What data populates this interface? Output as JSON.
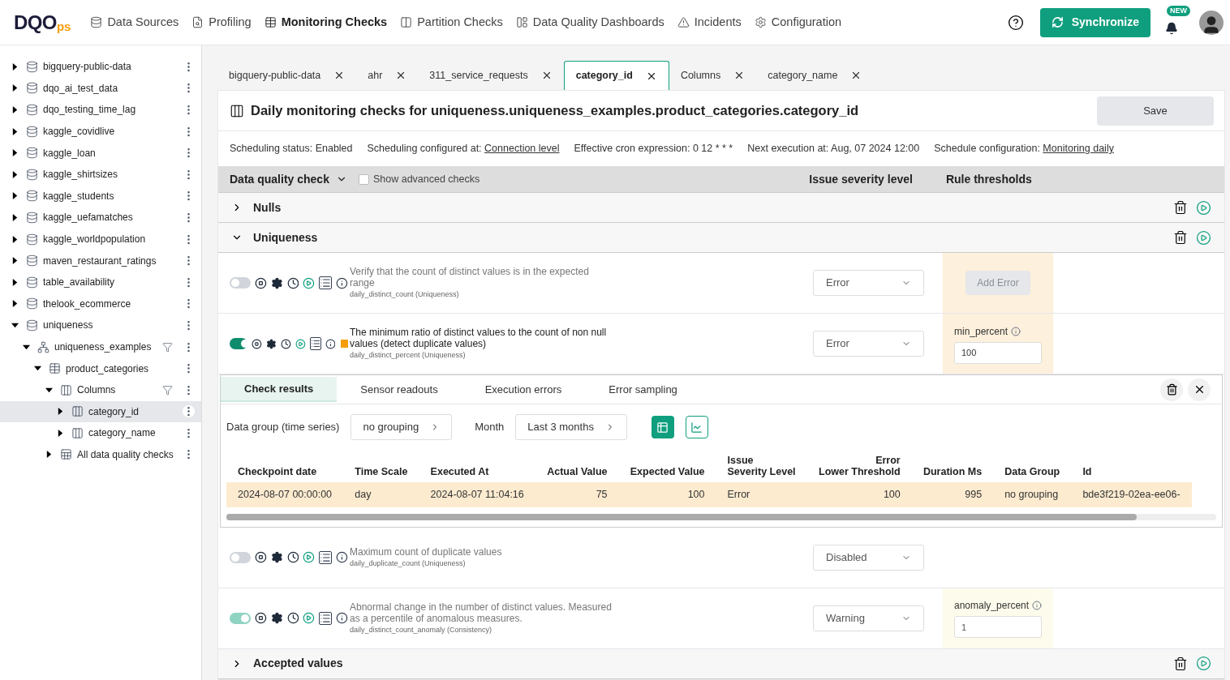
{
  "logo": {
    "main": "DQO",
    "suffix": "ps"
  },
  "nav": [
    {
      "label": "Data Sources",
      "selected": false
    },
    {
      "label": "Profiling",
      "selected": false
    },
    {
      "label": "Monitoring Checks",
      "selected": true
    },
    {
      "label": "Partition Checks",
      "selected": false
    },
    {
      "label": "Data Quality Dashboards",
      "selected": false
    },
    {
      "label": "Incidents",
      "selected": false
    },
    {
      "label": "Configuration",
      "selected": false
    }
  ],
  "sync_button": "Synchronize",
  "notifications_badge": "NEW",
  "tree": [
    {
      "label": "bigquery-public-data",
      "kind": "connection",
      "expanded": false,
      "selected": false,
      "filter": false
    },
    {
      "label": "dqo_ai_test_data",
      "kind": "connection",
      "expanded": false,
      "selected": false,
      "filter": false
    },
    {
      "label": "dqo_testing_time_lag",
      "kind": "connection",
      "expanded": false,
      "selected": false,
      "filter": false
    },
    {
      "label": "kaggle_covidlive",
      "kind": "connection",
      "expanded": false,
      "selected": false,
      "filter": false
    },
    {
      "label": "kaggle_loan",
      "kind": "connection",
      "expanded": false,
      "selected": false,
      "filter": false
    },
    {
      "label": "kaggle_shirtsizes",
      "kind": "connection",
      "expanded": false,
      "selected": false,
      "filter": false
    },
    {
      "label": "kaggle_students",
      "kind": "connection",
      "expanded": false,
      "selected": false,
      "filter": false
    },
    {
      "label": "kaggle_uefamatches",
      "kind": "connection",
      "expanded": false,
      "selected": false,
      "filter": false
    },
    {
      "label": "kaggle_worldpopulation",
      "kind": "connection",
      "expanded": false,
      "selected": false,
      "filter": false
    },
    {
      "label": "maven_restaurant_ratings",
      "kind": "connection",
      "expanded": false,
      "selected": false,
      "filter": false
    },
    {
      "label": "table_availability",
      "kind": "connection",
      "expanded": false,
      "selected": false,
      "filter": false
    },
    {
      "label": "thelook_ecommerce",
      "kind": "connection",
      "expanded": false,
      "selected": false,
      "filter": false
    },
    {
      "label": "uniqueness",
      "kind": "connection",
      "expanded": true,
      "selected": false,
      "filter": false,
      "children": [
        {
          "label": "uniqueness_examples",
          "kind": "schema",
          "expanded": true,
          "selected": false,
          "filter": true,
          "children": [
            {
              "label": "product_categories",
              "kind": "table",
              "expanded": true,
              "selected": false,
              "filter": false,
              "children": [
                {
                  "label": "Columns",
                  "kind": "column",
                  "expanded": true,
                  "selected": false,
                  "filter": true,
                  "children": [
                    {
                      "label": "category_id",
                      "kind": "column",
                      "expanded": false,
                      "selected": true,
                      "filter": false
                    },
                    {
                      "label": "category_name",
                      "kind": "column",
                      "expanded": false,
                      "selected": false,
                      "filter": false
                    }
                  ]
                },
                {
                  "label": "All data quality checks",
                  "kind": "checks",
                  "expanded": false,
                  "selected": false,
                  "filter": false
                }
              ]
            }
          ]
        }
      ]
    }
  ],
  "tabs": [
    {
      "label": "bigquery-public-data",
      "selected": false
    },
    {
      "label": "ahr",
      "selected": false
    },
    {
      "label": "311_service_requests",
      "selected": false
    },
    {
      "label": "category_id",
      "selected": true
    },
    {
      "label": "Columns",
      "selected": false
    },
    {
      "label": "category_name",
      "selected": false
    }
  ],
  "title": "Daily monitoring checks for uniqueness.uniqueness_examples.product_categories.category_id",
  "save_button": "Save",
  "schedule": [
    {
      "label": "Scheduling status:",
      "value": "Enabled",
      "link": false
    },
    {
      "label": "Scheduling configured at:",
      "value": "Connection level",
      "link": true
    },
    {
      "label": "Effective cron expression:",
      "value": "0 12 * * *",
      "link": false
    },
    {
      "label": "Next execution at:",
      "value": "Aug, 07 2024 12:00",
      "link": false
    },
    {
      "label": "Schedule configuration:",
      "value": "Monitoring daily",
      "link": true
    }
  ],
  "header": {
    "check": "Data quality check",
    "advanced": {
      "label": "Show advanced checks",
      "checked": false
    },
    "severity": "Issue severity level",
    "thresholds": "Rule thresholds"
  },
  "categories": [
    {
      "name": "Nulls",
      "expanded": false
    },
    {
      "name": "Uniqueness",
      "expanded": true,
      "checks": [
        {
          "on": false,
          "muted": true,
          "description": "Verify that the count of distinct values is in the expected range",
          "name": "daily_distinct_count (Uniqueness)",
          "severity": "Error",
          "threshold": {
            "kind": "button",
            "color": "#fdf0dc",
            "label": "Add Error"
          }
        },
        {
          "on": true,
          "muted": false,
          "color": "#f59e0b",
          "description": "The minimum ratio of distinct values to the count of non null values (detect duplicate values)",
          "name": "daily_distinct_percent (Uniqueness)",
          "severity": "Error",
          "threshold": {
            "kind": "field",
            "color": "#fdf0dc",
            "label": "min_percent",
            "value": "100"
          },
          "results": {
            "tabs": [
              {
                "label": "Check results",
                "selected": true
              },
              {
                "label": "Sensor readouts",
                "selected": false
              },
              {
                "label": "Execution errors",
                "selected": false
              },
              {
                "label": "Error sampling",
                "selected": false
              }
            ],
            "group_label": "Data group (time series)",
            "group_value": "no grouping",
            "month_label": "Month",
            "month_value": "Last 3 months",
            "columns": [
              {
                "label": "Checkpoint date",
                "kind": "text"
              },
              {
                "label": "Time Scale",
                "kind": "text"
              },
              {
                "label": "Executed At",
                "kind": "text"
              },
              {
                "label": "Actual Value",
                "kind": "number"
              },
              {
                "label": "Expected Value",
                "kind": "number"
              },
              {
                "label": "Issue\nSeverity Level",
                "kind": "text"
              },
              {
                "label": "Error\nLower Threshold",
                "kind": "number"
              },
              {
                "label": "Duration Ms",
                "kind": "number"
              },
              {
                "label": "Data Group",
                "kind": "text"
              },
              {
                "label": "Id",
                "kind": "text"
              }
            ],
            "rows": [
              [
                "2024-08-07 00:00:00",
                "day",
                "2024-08-07 11:04:16",
                "75",
                "100",
                "Error",
                "100",
                "995",
                "no grouping",
                "bde3f219-02ea-ee06-"
              ]
            ]
          }
        },
        {
          "on": false,
          "muted": true,
          "description": "Maximum count of duplicate values",
          "name": "daily_duplicate_count (Uniqueness)",
          "severity": "Disabled"
        },
        {
          "on": true,
          "muted": true,
          "description": "Abnormal change in the number of distinct values. Measured as a percentile of anomalous measures.",
          "name": "daily_distinct_count_anomaly (Consistency)",
          "severity": "Warning",
          "threshold": {
            "kind": "field",
            "color": "#fdfcec",
            "label": "anomaly_percent",
            "value": "1"
          }
        }
      ]
    },
    {
      "name": "Accepted values",
      "expanded": false
    }
  ]
}
